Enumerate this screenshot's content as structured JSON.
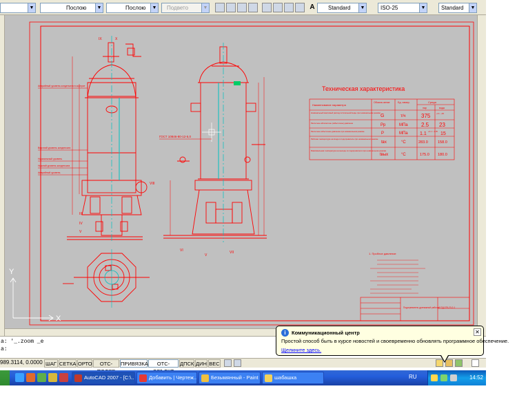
{
  "toolbar": {
    "linetype_value": "Послою",
    "lineweight_value": "Послою",
    "plotstyle_value": "Подвето",
    "textstyle_value": "Standard",
    "dimstyle_value": "ISO-25",
    "tablestyle_value": "Standard"
  },
  "drawing": {
    "tech_title": "Техническая характеристика",
    "table_header": [
      "Наименование параметра",
      "Обозна-чение",
      "Ед. измер.",
      "Среда"
    ],
    "media": [
      "пар",
      "вода"
    ],
    "rows": [
      {
        "name": "Номинальный массовый расход питательной воды при номинальном режиме",
        "sym": "G",
        "unit": "т/ч",
        "v1": "375",
        "v1sup": "+5 / −25",
        "v2": ""
      },
      {
        "name": "Расчетное абсолютное (избыточное) давление",
        "sym": "Pр",
        "unit": "МПа",
        "v1": "2.5",
        "v1sup": "",
        "v2": "23"
      },
      {
        "name": "Расчетное избыточное давление при номинальном режиме",
        "sym": "P",
        "unit": "МПа",
        "v1": "1.1",
        "v1sup": "+0.1 / −0.05",
        "v2": "15"
      },
      {
        "name": "Рабочая температура на входе в подогреватель при номинальном режиме",
        "sym": "tвх",
        "unit": "°С",
        "v1": "283.0",
        "v1sup": "",
        "v2": "158.0"
      },
      {
        "name": "Максимальная температура на выходе из подогревателя при номинальном режиме",
        "sym": "tвых",
        "unit": "°С",
        "v1": "175.0",
        "v1sup": "",
        "v2": "180.0"
      }
    ],
    "gost_label": "ГОСТ 10846-80-12-5,0",
    "title_block": "Подогреватель дренажный рабочий ПД-375-23-2-1",
    "notes_header": "1. Пробное давление",
    "callouts_roman": [
      "I",
      "II",
      "III",
      "IV",
      "V",
      "VI",
      "VII",
      "VIII",
      "IX",
      "X"
    ],
    "level_labels": [
      "Аварийный уровень конденсата в корпусе",
      "Верхний уровень конденсата",
      "Нормальный уровень",
      "Нижний уровень конденсата",
      "Аварийный уровень"
    ]
  },
  "ucs": {
    "y": "Y",
    "x": "X"
  },
  "command_line": {
    "line1": "а: '_.zoom _e",
    "line2": "а:"
  },
  "status": {
    "coords": "989.3114, 0.0000",
    "buttons": [
      "ШАГ",
      "СЕТКА",
      "ОРТО",
      "ОТС-ПОЛЯР",
      "ПРИВЯЗКА",
      "ОТС-ОБЪЕКТ",
      "ДПСК",
      "ДИН",
      "ВЕС"
    ]
  },
  "balloon": {
    "title": "Коммуникационный центр",
    "message": "Простой способ быть в курсе новостей и своевременно обновлять программное обеспечение.",
    "link": "Щелкните здесь.",
    "close": "✕",
    "info": "i"
  },
  "taskbar": {
    "tasks": [
      "AutoCAD 2007 - [C:\\...",
      "Добавить | Чертеж...",
      "Безымянный - Paint",
      "шабашка"
    ],
    "lang": "RU",
    "clock": "14:52"
  }
}
